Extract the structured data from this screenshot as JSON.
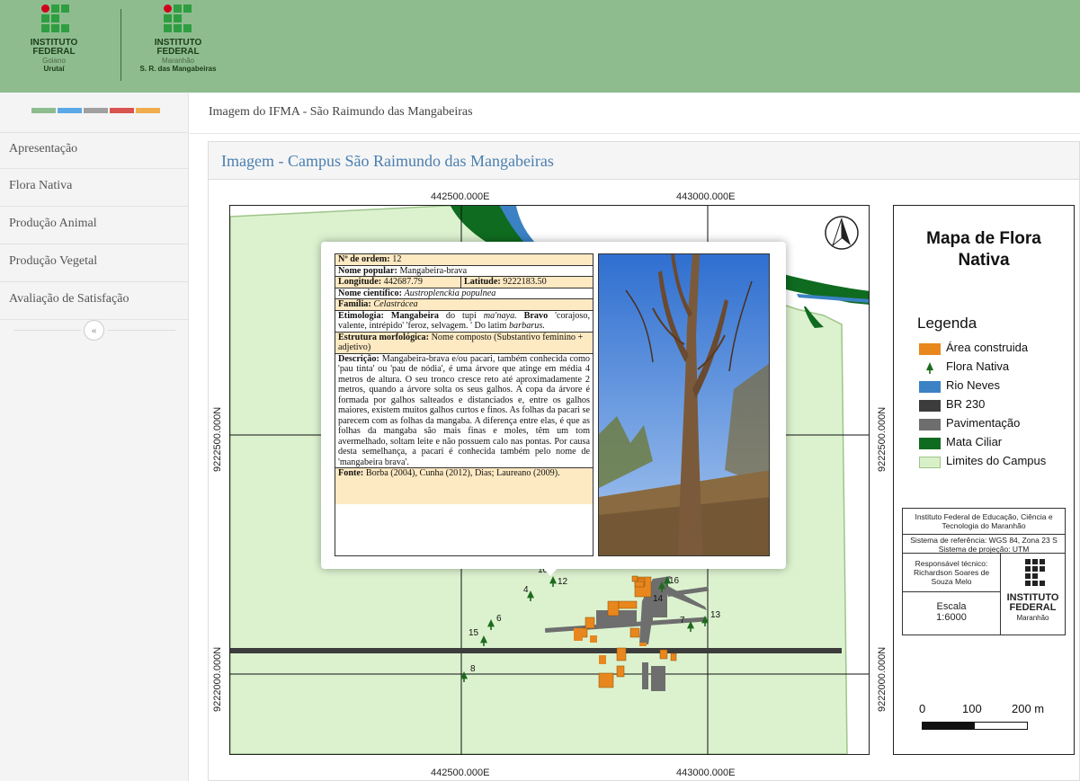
{
  "header": {
    "logo1": {
      "line1": "INSTITUTO",
      "line2": "FEDERAL",
      "line3": "Goiano",
      "line4": "Urutaí"
    },
    "logo2": {
      "line1": "INSTITUTO",
      "line2": "FEDERAL",
      "line3": "Maranhão",
      "line4": "S. R. das Mangabeiras"
    }
  },
  "sidebar": {
    "colors": [
      "#8fbc8f",
      "#5aa9e6",
      "#a0a0a0",
      "#d9534f",
      "#f0ad4e"
    ],
    "items": [
      {
        "label": "Apresentação"
      },
      {
        "label": "Flora Nativa"
      },
      {
        "label": "Produção Animal"
      },
      {
        "label": "Produção Vegetal"
      },
      {
        "label": "Avaliação de Satisfação"
      }
    ],
    "collapse_icon": "«"
  },
  "breadcrumb": "Imagem do IFMA - São Raimundo das Mangabeiras",
  "panel": {
    "title": "Imagem - Campus São Raimundo das Mangabeiras"
  },
  "map": {
    "coord_top_1": "442500.000E",
    "coord_top_2": "443000.000E",
    "coord_bottom_1": "442500.000E",
    "coord_bottom_2": "443000.000E",
    "coord_left_1": "9222500.000N",
    "coord_left_2": "9222000.000N",
    "coord_right_1": "9222500.000N",
    "coord_right_2": "9222000.000N",
    "tree_labels": [
      "10",
      "12",
      "4",
      "6",
      "15",
      "8",
      "16",
      "14",
      "7",
      "13"
    ]
  },
  "popup": {
    "ordem_label": "Nº de ordem:",
    "ordem": "12",
    "nome_label": "Nome popular:",
    "nome": "Mangabeira-brava",
    "long_label": "Longitude:",
    "long": "442687.79",
    "lat_label": "Latitude:",
    "lat": "9222183.50",
    "cient_label": "Nome científico:",
    "cient": "Austroplenckia populnea",
    "familia_label": "Família:",
    "familia": "Celastrácea",
    "etimo_label": "Etimologia:",
    "etimo_1": "Mangabeira",
    "etimo_2": "do tupi",
    "etimo_3": "ma'naya.",
    "etimo_4": "Bravo",
    "etimo_5": "'corajoso, valente, intrépido' 'feroz, selvagem. ' Do latim",
    "etimo_6": "barbarus.",
    "estr_label": "Estrutura morfológica:",
    "estr": "Nome composto (Substantivo feminino + adjetivo)",
    "desc_label": "Descrição:",
    "desc": "Mangabeira-brava e/ou pacari, também conhecida como 'pau tinta' ou 'pau de nódia', é uma árvore que atinge em média 4 metros de altura. O seu tronco cresce reto até aproximadamente 2 metros, quando a árvore solta os seus galhos. A copa da árvore é formada por galhos salteados e distanciados e, entre os galhos maiores, existem muitos galhos curtos e finos. As folhas da pacari se parecem com as folhas da mangaba. A diferença entre elas, é que as folhas da mangaba são mais finas e moles, têm um tom avermelhado, soltam leite e não possuem calo nas pontas. Por causa desta semelhança, a pacari é conhecida também pelo nome de 'mangabeira brava'.",
    "fonte_label": "Fonte:",
    "fonte": "Borba (2004), Cunha (2012), Dias; Laureano (2009)."
  },
  "legend": {
    "title_1": "Mapa de Flora",
    "title_2": "Nativa",
    "heading": "Legenda",
    "items": [
      {
        "label": "Área construida",
        "color": "#e8871e"
      },
      {
        "label": "Flora Nativa",
        "color": "#1e6b1e"
      },
      {
        "label": "Rio Neves",
        "color": "#3b82c4"
      },
      {
        "label": "BR 230",
        "color": "#3c3c3c"
      },
      {
        "label": "Pavimentação",
        "color": "#6e6e6e"
      },
      {
        "label": "Mata Ciliar",
        "color": "#0f6b1f"
      },
      {
        "label": "Limites do Campus",
        "color": "#d8f0c8"
      }
    ],
    "inst": "Instituto Federal de Educação, Ciência e Tecnologia do Maranhão",
    "ref": "Sistema de referência: WGS 84, Zona 23 S Sistema de projeção: UTM",
    "resp": "Responsável técnico: Richardson Soares de Souza Melo",
    "escala_label": "Escala",
    "escala": "1:6000",
    "logo_l1": "INSTITUTO",
    "logo_l2": "FEDERAL",
    "logo_l3": "Maranhão",
    "scale_0": "0",
    "scale_100": "100",
    "scale_200": "200 m"
  }
}
